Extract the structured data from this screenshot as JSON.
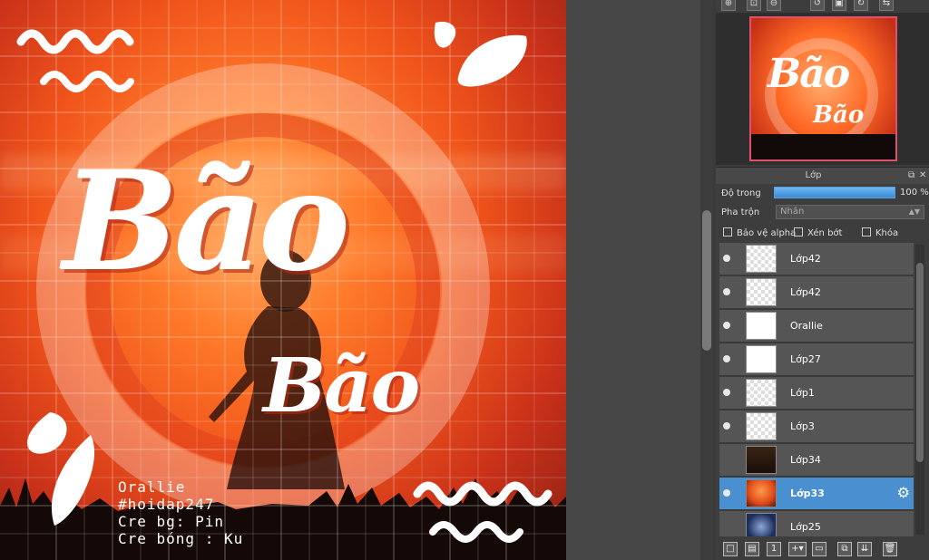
{
  "artwork": {
    "title_big": "Bão",
    "title_small": "Bão",
    "credits": [
      "Orallie",
      "#hoidap247",
      "Cre bg: Pin",
      "Cre bóng : Ku"
    ]
  },
  "navigator": {
    "toolbar_icons": [
      "zoom-in-icon",
      "zoom-fit-icon",
      "zoom-out-icon",
      "rotate-left-icon",
      "fit-window-icon",
      "rotate-right-icon",
      "flip-icon"
    ],
    "preview_title": "Bão",
    "preview_sub": "Bão"
  },
  "layer_panel": {
    "title": "Lớp",
    "opacity_label": "Độ trong",
    "opacity_value": "100 %",
    "opacity_fraction": 1.0,
    "blend_label": "Pha trộn",
    "blend_value": "Nhân",
    "checkboxes": {
      "protect_alpha": "Bảo vệ alpha",
      "clipping": "Xén bớt",
      "lock": "Khóa"
    },
    "layers": [
      {
        "name": "Lớp42",
        "visible": true,
        "thumb": "transparent"
      },
      {
        "name": "Lớp42",
        "visible": true,
        "thumb": "transparent"
      },
      {
        "name": "Orallie",
        "visible": true,
        "thumb": "white"
      },
      {
        "name": "Lớp27",
        "visible": true,
        "thumb": "white"
      },
      {
        "name": "Lớp1",
        "visible": true,
        "thumb": "transparent"
      },
      {
        "name": "Lớp3",
        "visible": true,
        "thumb": "transparent"
      },
      {
        "name": "Lớp34",
        "visible": false,
        "thumb": "dark"
      },
      {
        "name": "Lớp33",
        "visible": true,
        "thumb": "sunset",
        "selected": true
      },
      {
        "name": "Lớp25",
        "visible": false,
        "thumb": "blue"
      }
    ]
  },
  "colors": {
    "selected_layer": "#4a90d0",
    "opacity_bar": "#4a9ae0",
    "nav_frame": "#e0506a"
  }
}
